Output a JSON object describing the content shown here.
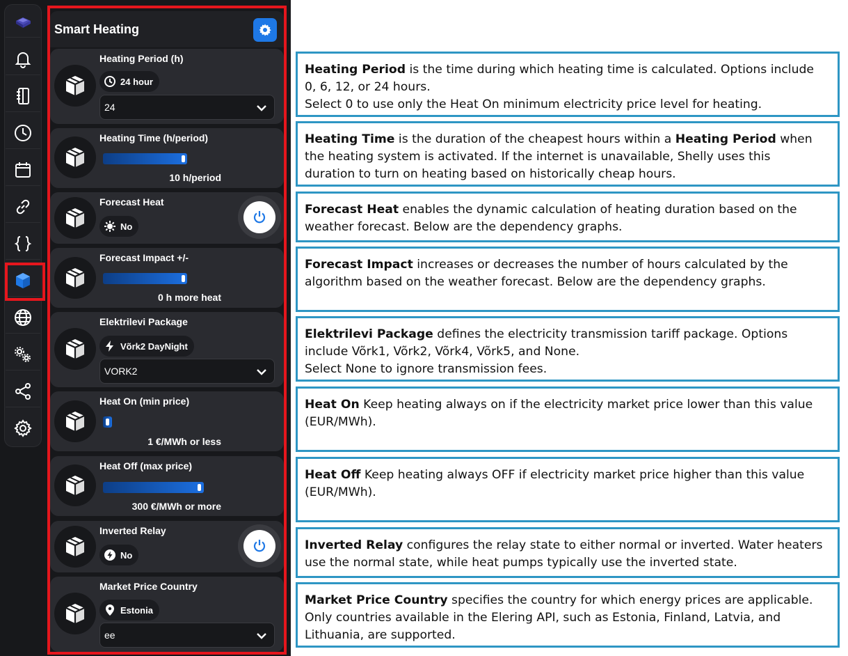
{
  "app": {
    "title": "Smart Heating"
  },
  "rail": {
    "items": [
      "bell-icon",
      "notebook-icon",
      "clock-icon",
      "calendar-icon",
      "link-icon",
      "braces-icon",
      "cube-icon",
      "globe-icon",
      "gears-icon",
      "share-icon",
      "settings-icon"
    ],
    "active": "cube-icon"
  },
  "colors": {
    "accent": "#1e78e6",
    "highlight": "#e5161d",
    "panel": "#2a2b30",
    "border": "#2e96c4"
  },
  "cards": {
    "heating_period": {
      "title": "Heating Period (h)",
      "chip": "24 hour",
      "select_value": "24"
    },
    "heating_time": {
      "title": "Heating Time (h/period)",
      "value_label": "10 h/period",
      "value": 10
    },
    "forecast_heat": {
      "title": "Forecast Heat",
      "chip": "No",
      "toggle": "off"
    },
    "forecast_impact": {
      "title": "Forecast Impact +/-",
      "value_label": "0 h more heat",
      "value": 0
    },
    "elektrilevi": {
      "title": "Elektrilevi Package",
      "chip": "Võrk2 DayNight",
      "select_value": "VORK2"
    },
    "heat_on": {
      "title": "Heat On (min price)",
      "value_label": "1 €/MWh or less",
      "value": 1
    },
    "heat_off": {
      "title": "Heat Off (max price)",
      "value_label": "300 €/MWh or more",
      "value": 300
    },
    "inverted_relay": {
      "title": "Inverted Relay",
      "chip": "No",
      "toggle": "off"
    },
    "market_country": {
      "title": "Market Price Country",
      "chip": "Estonia",
      "select_value": "ee"
    }
  },
  "descriptions": {
    "heating_period": {
      "term": "Heating Period",
      "line1": " is the time during which heating time is calculated. Options include",
      "line2": "0, 6, 12, or 24 hours.",
      "line3": "Select 0 to use only the Heat On minimum electricity price level for heating."
    },
    "heating_time": {
      "term": "Heating Time",
      "mid": " is the duration of the cheapest hours within a ",
      "term2": "Heating Period",
      "after": " when",
      "line2": "the heating system is activated. If the internet is unavailable, Shelly uses this",
      "line3": "duration to turn on heating based on historically cheap hours."
    },
    "forecast_heat": {
      "term": "Forecast Heat",
      "line1": " enables the dynamic calculation of heating duration based on the",
      "line2": "weather forecast. Below are the dependency graphs."
    },
    "forecast_impact": {
      "term": "Forecast Impact",
      "line1": " increases or decreases the number of hours calculated by the",
      "line2": "algorithm based on the weather forecast. Below are the dependency graphs."
    },
    "elektrilevi": {
      "term": "Elektrilevi Package",
      "line1": " defines the electricity transmission tariff package. Options",
      "line2": "include Võrk1, Võrk2, Võrk4, Võrk5, and None.",
      "line3": "Select None to ignore transmission fees."
    },
    "heat_on": {
      "term": "Heat On",
      "line1": " Keep heating always on if the electricity market price lower than this value",
      "line2": "(EUR/MWh)."
    },
    "heat_off": {
      "term": "Heat Off",
      "line1": " Keep heating always OFF if electricity market price higher than this value",
      "line2": "(EUR/MWh)."
    },
    "inverted_relay": {
      "term": "Inverted Relay",
      "line1": " configures the relay state to either normal or inverted. Water heaters",
      "line2": "use the normal state, while heat pumps typically use the inverted state."
    },
    "market_country": {
      "term": "Market Price Country",
      "line1": " specifies the country for which energy prices are applicable.",
      "line2": "Only countries available in the Elering API, such as Estonia, Finland, Latvia, and",
      "line3": "Lithuania, are supported."
    }
  }
}
